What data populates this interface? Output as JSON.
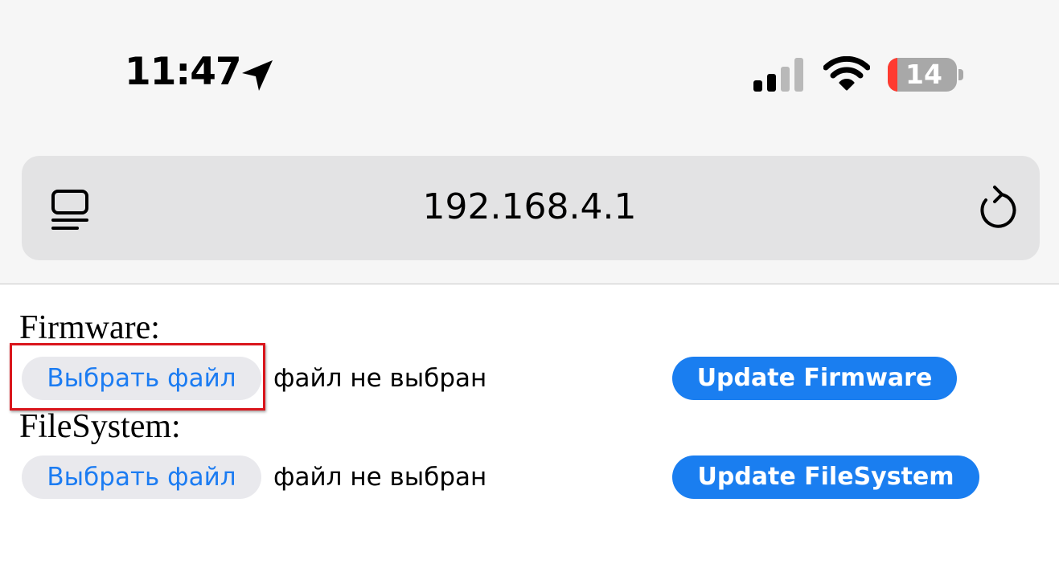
{
  "status_bar": {
    "time": "11:47",
    "battery_level": "14",
    "battery_fraction": 0.14,
    "icons": [
      "location-arrow-icon",
      "cellular-signal-icon",
      "wifi-icon",
      "battery-icon"
    ]
  },
  "browser": {
    "url": "192.168.4.1",
    "icons": [
      "reader-menu-icon",
      "reload-icon"
    ]
  },
  "page": {
    "firmware": {
      "label": "Firmware:",
      "choose_file": "Выбрать файл",
      "no_file": "файл не выбран",
      "update": "Update Firmware"
    },
    "filesystem": {
      "label": "FileSystem:",
      "choose_file": "Выбрать файл",
      "no_file": "файл не выбран",
      "update": "Update FileSystem"
    }
  },
  "colors": {
    "accent": "#1a7ef0",
    "link_text": "#1c7cf2",
    "highlight": "#d9161c",
    "battery_low": "#ff3b30"
  }
}
